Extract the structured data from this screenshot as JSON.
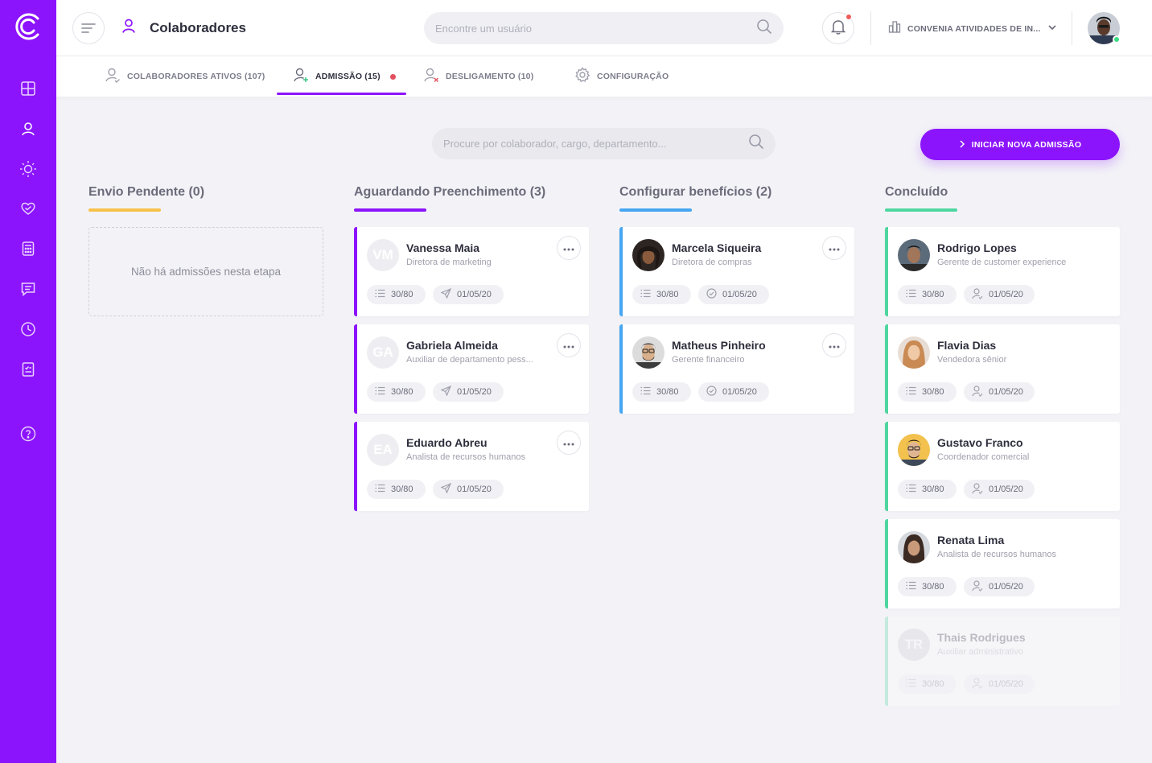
{
  "app": {
    "page_title": "Colaboradores",
    "search_placeholder": "Encontre um usuário",
    "company": "CONVENIA ATIVIDADES DE IN...",
    "brand_color": "#8c14fc"
  },
  "sidebar": {
    "items": [
      {
        "icon": "dashboard-icon"
      },
      {
        "icon": "user-icon"
      },
      {
        "icon": "sun-icon"
      },
      {
        "icon": "heart-icon"
      },
      {
        "icon": "calculator-icon"
      },
      {
        "icon": "chat-icon"
      },
      {
        "icon": "clock-icon"
      },
      {
        "icon": "report-icon"
      },
      {
        "icon": "help-icon"
      }
    ]
  },
  "tabs": [
    {
      "label": "COLABORADORES ATIVOS (107)"
    },
    {
      "label": "ADMISSÃO (15)"
    },
    {
      "label": "DESLIGAMENTO (10)"
    },
    {
      "label": "CONFIGURAÇÃO"
    }
  ],
  "board": {
    "search_placeholder": "Procure por colaborador, cargo, departamento...",
    "new_button": "INICIAR NOVA ADMISSÃO",
    "columns": [
      {
        "title": "Envio Pendente (0)",
        "color": "#f7c14c",
        "empty_text": "Não há admissões nesta etapa",
        "cards": []
      },
      {
        "title": "Aguardando Preenchimento (3)",
        "color": "#8c14fc",
        "cards": [
          {
            "initials": "VM",
            "name": "Vanessa Maia",
            "role": "Diretora de marketing",
            "progress": "30/80",
            "date": "01/05/20"
          },
          {
            "initials": "GA",
            "name": "Gabriela Almeida",
            "role": "Auxiliar de departamento pess...",
            "progress": "30/80",
            "date": "01/05/20"
          },
          {
            "initials": "EA",
            "name": "Eduardo Abreu",
            "role": "Analista de recursos humanos",
            "progress": "30/80",
            "date": "01/05/20"
          }
        ]
      },
      {
        "title": "Configurar benefícios (2)",
        "color": "#46a6f2",
        "cards": [
          {
            "name": "Marcela Siqueira",
            "role": "Diretora de compras",
            "progress": "30/80",
            "date": "01/05/20"
          },
          {
            "name": "Matheus Pinheiro",
            "role": "Gerente financeiro",
            "progress": "30/80",
            "date": "01/05/20"
          }
        ]
      },
      {
        "title": "Concluído",
        "color": "#4fd6a0",
        "cards": [
          {
            "name": "Rodrigo Lopes",
            "role": "Gerente de customer experience",
            "progress": "30/80",
            "date": "01/05/20"
          },
          {
            "name": "Flavia Dias",
            "role": "Vendedora sênior",
            "progress": "30/80",
            "date": "01/05/20"
          },
          {
            "name": "Gustavo Franco",
            "role": "Coordenador comercial",
            "progress": "30/80",
            "date": "01/05/20"
          },
          {
            "name": "Renata Lima",
            "role": "Analista de recursos humanos",
            "progress": "30/80",
            "date": "01/05/20"
          },
          {
            "initials": "TR",
            "name": "Thais Rodrigues",
            "role": "Auxiliar administrativo",
            "progress": "30/80",
            "date": "01/05/20"
          }
        ]
      }
    ]
  }
}
